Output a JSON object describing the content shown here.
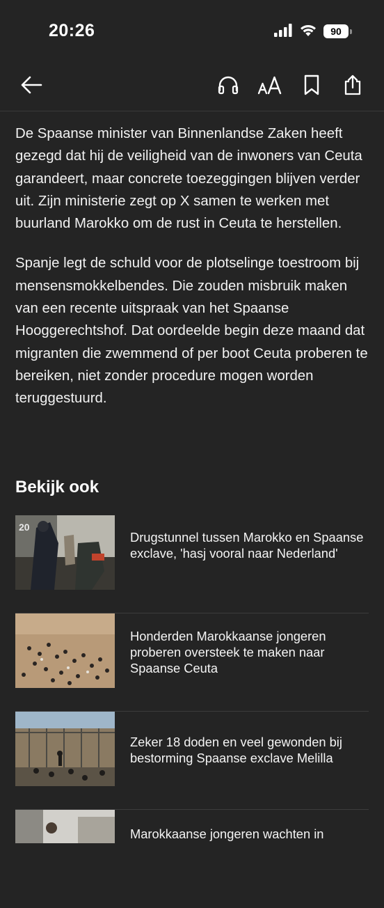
{
  "status_bar": {
    "time": "20:26",
    "battery": "90"
  },
  "nav": {
    "back_icon": "arrow-left-icon",
    "listen_icon": "headphones-icon",
    "text_size_icon": "text-size-icon",
    "bookmark_icon": "bookmark-icon",
    "share_icon": "share-icon"
  },
  "article": {
    "paragraphs": [
      "De Spaanse minister van Binnenlandse Zaken heeft gezegd dat hij de veiligheid van de inwoners van Ceuta garandeert, maar concrete toezeggingen blijven verder uit. Zijn ministerie zegt op X samen te werken met buurland Marokko om de rust in Ceuta te herstellen.",
      "Spanje legt de schuld voor de plotselinge toestroom bij mensensmokkelbendes. Die zouden misbruik maken van een recente uitspraak van het Spaanse Hooggerechtshof. Dat oordeelde begin deze maand dat migranten die zwemmend of per boot Ceuta proberen te bereiken, niet zonder procedure mogen worden teruggestuurd."
    ]
  },
  "related": {
    "title": "Bekijk ook",
    "items": [
      {
        "title": "Drugstunnel tussen Marokko en Spaanse exclave, 'hasj vooral naar Nederland'"
      },
      {
        "title": "Honderden Marokkaanse jongeren proberen oversteek te maken naar Spaanse Ceuta"
      },
      {
        "title": "Zeker 18 doden en veel gewonden bij bestorming Spaanse exclave Melilla"
      },
      {
        "title": "Marokkaanse jongeren wachten in"
      }
    ]
  },
  "colors": {
    "background": "#242424",
    "text": "#ffffff",
    "divider": "#3c3c3c"
  }
}
